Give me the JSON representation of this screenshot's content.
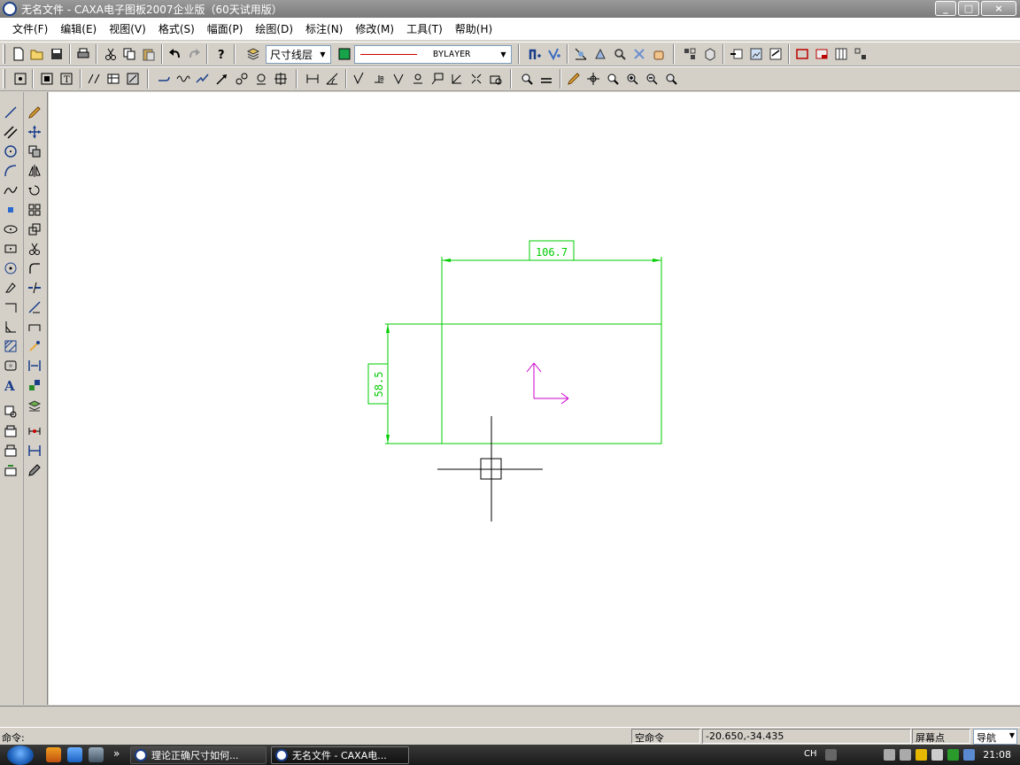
{
  "window": {
    "title": "无名文件 - CAXA电子图板2007企业版（60天试用版）",
    "minimize": "_",
    "maximize": "□",
    "close": "×"
  },
  "menu": [
    {
      "label": "文件(F)"
    },
    {
      "label": "编辑(E)"
    },
    {
      "label": "视图(V)"
    },
    {
      "label": "格式(S)"
    },
    {
      "label": "幅面(P)"
    },
    {
      "label": "绘图(D)"
    },
    {
      "label": "标注(N)"
    },
    {
      "label": "修改(M)"
    },
    {
      "label": "工具(T)"
    },
    {
      "label": "帮助(H)"
    }
  ],
  "layer_combo": {
    "value": "尺寸线层"
  },
  "linetype_combo": {
    "value": "BYLAYER"
  },
  "drawing": {
    "dim_horizontal": "106.7",
    "dim_vertical": "58.5",
    "line_color": "#00cc00",
    "axis_color": "#cc00cc"
  },
  "status": {
    "command_label": "命令:",
    "state": "空命令",
    "coords": "-20.650,-34.435",
    "snap_mode": "屏幕点",
    "nav": "导航"
  },
  "taskbar": {
    "task1": "理论正确尺寸如何...",
    "task2": "无名文件 - CAXA电...",
    "lang": "CH",
    "clock": "21:08",
    "more": "»"
  }
}
